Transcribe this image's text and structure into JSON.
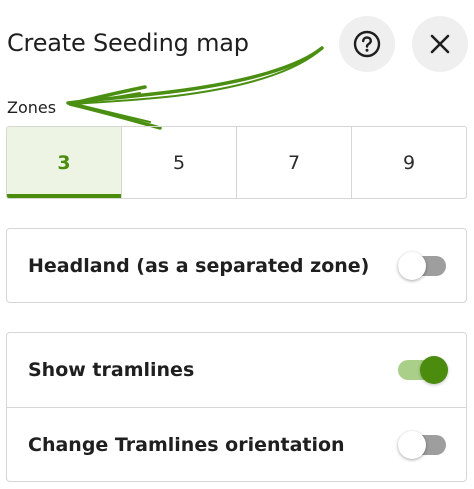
{
  "header": {
    "title": "Create Seeding map",
    "help_icon": "help-circle-icon",
    "close_icon": "close-icon"
  },
  "zones": {
    "label": "Zones",
    "options": [
      "3",
      "5",
      "7",
      "9"
    ],
    "selected": "3"
  },
  "settings": {
    "headland": {
      "label": "Headland (as a separated zone)",
      "enabled": false
    },
    "show_tramlines": {
      "label": "Show tramlines",
      "enabled": true
    },
    "change_tramlines_orientation": {
      "label": "Change Tramlines orientation",
      "enabled": false
    }
  },
  "colors": {
    "accent": "#4b8b0d",
    "accent_light": "#eef4e3",
    "toggle_on_track": "#a9cf88",
    "toggle_off_track": "#9e9e9e",
    "annotation_arrow": "#4a8f12"
  }
}
